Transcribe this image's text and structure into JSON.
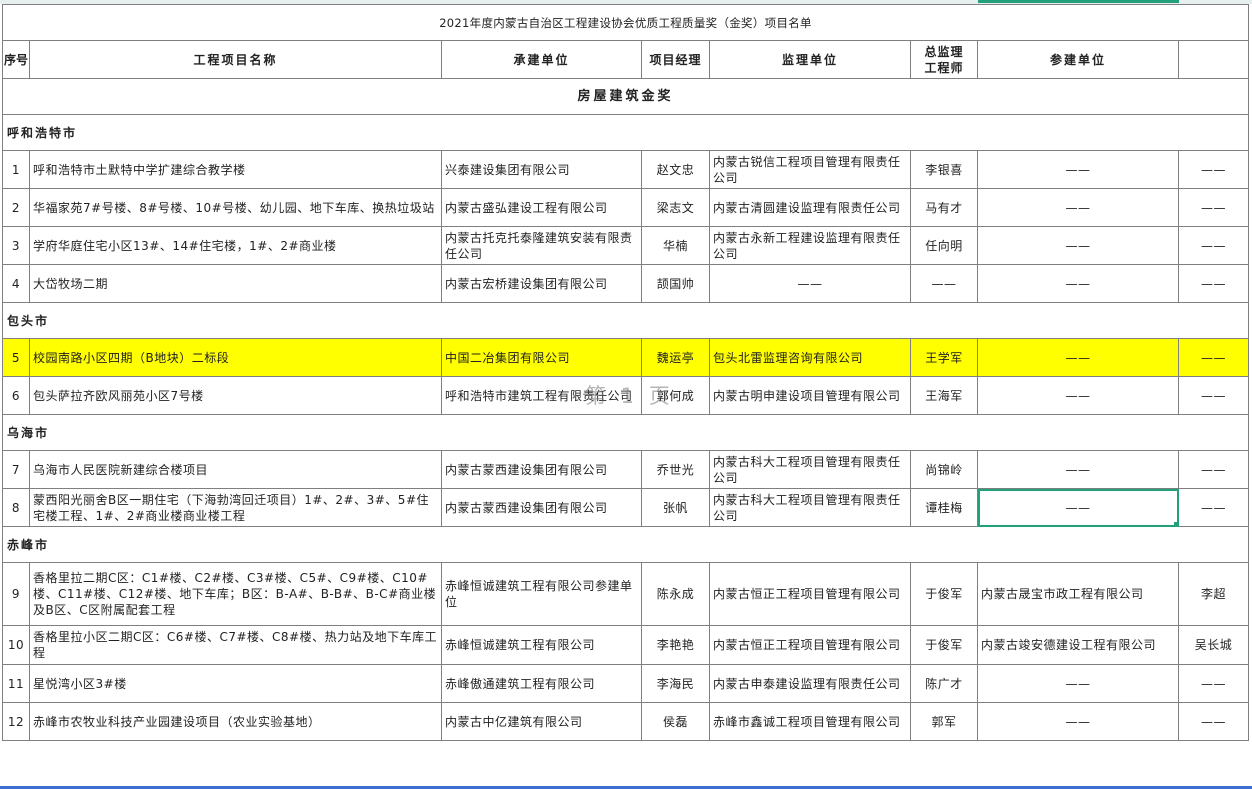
{
  "sheet_title": "2021年度内蒙古自治区工程建设协会优质工程质量奖（金奖）项目名单",
  "header": {
    "seq": "序号",
    "project": "工程项目名称",
    "contractor": "承建单位",
    "manager": "项目经理",
    "supervisor": "监理单位",
    "chief_line1": "总监理",
    "chief_line2": "工程师",
    "participant": "参建单位",
    "last": ""
  },
  "section_title": "房屋建筑金奖",
  "cities": [
    "呼和浩特市",
    "包头市",
    "乌海市",
    "赤峰市"
  ],
  "rows": [
    {
      "no": "1",
      "project": "呼和浩特市土默特中学扩建综合教学楼",
      "contractor": "兴泰建设集团有限公司",
      "manager": "赵文忠",
      "supervisor": "内蒙古锐信工程项目管理有限责任公司",
      "chief": "李银喜",
      "participant": "——",
      "extra": "——"
    },
    {
      "no": "2",
      "project": "华福家苑7#号楼、8#号楼、10#号楼、幼儿园、地下车库、换热垃圾站",
      "contractor": "内蒙古盛弘建设工程有限公司",
      "manager": "梁志文",
      "supervisor": "内蒙古清圆建设监理有限责任公司",
      "chief": "马有才",
      "participant": "——",
      "extra": "——"
    },
    {
      "no": "3",
      "project": "学府华庭住宅小区13#、14#住宅楼，1#、2#商业楼",
      "contractor": "内蒙古托克托泰隆建筑安装有限责任公司",
      "manager": "华楠",
      "supervisor": "内蒙古永新工程建设监理有限责任公司",
      "chief": "任向明",
      "participant": "——",
      "extra": "——"
    },
    {
      "no": "4",
      "project": "大岱牧场二期",
      "contractor": "内蒙古宏桥建设集团有限公司",
      "manager": "颉国帅",
      "supervisor": "——",
      "chief": "——",
      "participant": "——",
      "extra": "——"
    },
    {
      "no": "5",
      "project": "校园南路小区四期（B地块）二标段",
      "contractor": "中国二冶集团有限公司",
      "manager": "魏运亭",
      "supervisor": "包头北雷监理咨询有限公司",
      "chief": "王学军",
      "participant": "——",
      "extra": "——"
    },
    {
      "no": "6",
      "project": "包头萨拉齐欧风丽苑小区7号楼",
      "contractor": "呼和浩特市建筑工程有限责任公司",
      "manager": "郭何成",
      "supervisor": "内蒙古明申建设项目管理有限公司",
      "chief": "王海军",
      "participant": "——",
      "extra": "——"
    },
    {
      "no": "7",
      "project": "乌海市人民医院新建综合楼项目",
      "contractor": "内蒙古蒙西建设集团有限公司",
      "manager": "乔世光",
      "supervisor": "内蒙古科大工程项目管理有限责任公司",
      "chief": "尚锦岭",
      "participant": "——",
      "extra": "——"
    },
    {
      "no": "8",
      "project": "蒙西阳光丽舍B区一期住宅（下海勃湾回迁项目）1#、2#、3#、5#住宅楼工程、1#、2#商业楼商业楼工程",
      "contractor": "内蒙古蒙西建设集团有限公司",
      "manager": "张帆",
      "supervisor": "内蒙古科大工程项目管理有限责任公司",
      "chief": "谭桂梅",
      "participant": "——",
      "extra": "——"
    },
    {
      "no": "9",
      "project": "香格里拉二期C区：C1#楼、C2#楼、C3#楼、C5#、C9#楼、C10#楼、C11#楼、C12#楼、地下车库；B区：B-A#、B-B#、B-C#商业楼及B区、C区附属配套工程",
      "contractor": "赤峰恒诚建筑工程有限公司参建单位",
      "manager": "陈永成",
      "supervisor": "内蒙古恒正工程项目管理有限公司",
      "chief": "于俊军",
      "participant": "内蒙古晟宝市政工程有限公司",
      "extra": "李超"
    },
    {
      "no": "10",
      "project": "香格里拉小区二期C区：C6#楼、C7#楼、C8#楼、热力站及地下车库工程",
      "contractor": "赤峰恒诚建筑工程有限公司",
      "manager": "李艳艳",
      "supervisor": "内蒙古恒正工程项目管理有限公司",
      "chief": "于俊军",
      "participant": "内蒙古竣安德建设工程有限公司",
      "extra": "吴长城"
    },
    {
      "no": "11",
      "project": "星悦湾小区3#楼",
      "contractor": "赤峰傲通建筑工程有限公司",
      "manager": "李海民",
      "supervisor": "内蒙古申泰建设监理有限责任公司",
      "chief": "陈广才",
      "participant": "——",
      "extra": "——"
    },
    {
      "no": "12",
      "project": "赤峰市农牧业科技产业园建设项目（农业实验基地）",
      "contractor": "内蒙古中亿建筑有限公司",
      "manager": "侯磊",
      "supervisor": "赤峰市鑫诚工程项目管理有限公司",
      "chief": "郭军",
      "participant": "——",
      "extra": "——"
    }
  ],
  "watermark": "第 1 页",
  "colors": {
    "highlight": "#ffff00",
    "selection": "#21a07a",
    "grid": "#7f7f7f"
  }
}
